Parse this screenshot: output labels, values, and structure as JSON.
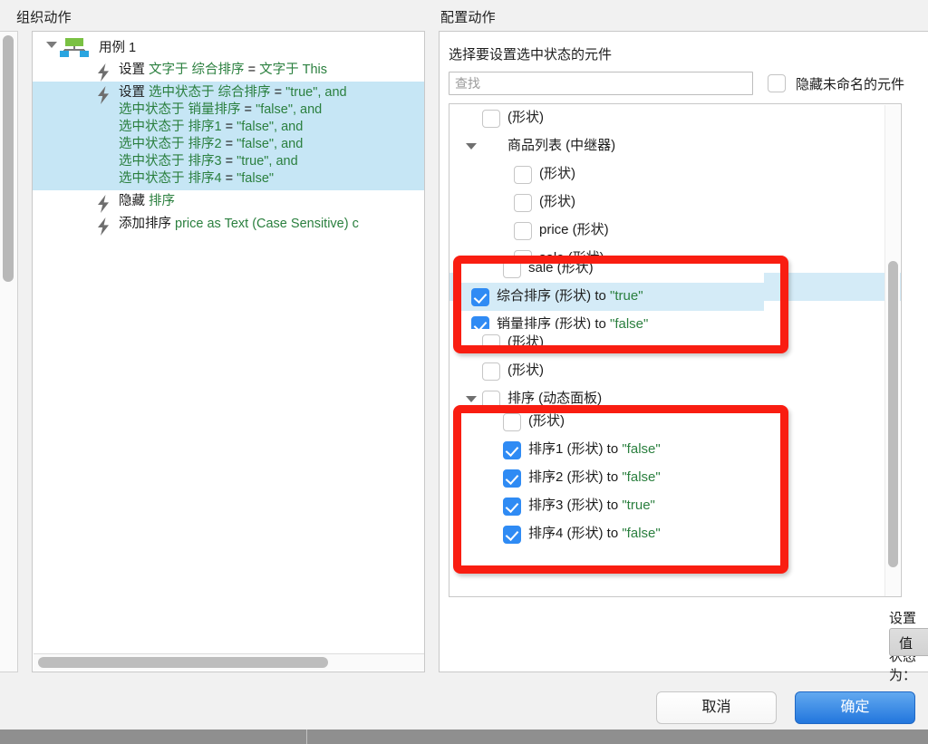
{
  "org": {
    "title": "组织动作",
    "root": {
      "label": "用例 1",
      "icon": "hierarchy-icon",
      "expanded": true
    },
    "actions": [
      {
        "selected": false,
        "lines": [
          [
            {
              "t": "设置 ",
              "c": "k"
            },
            {
              "t": "文字于 综合排序",
              "c": "g"
            },
            {
              "t": " = ",
              "c": "k"
            },
            {
              "t": "文字于 This",
              "c": "g"
            }
          ]
        ]
      },
      {
        "selected": true,
        "lines": [
          [
            {
              "t": "设置 ",
              "c": "k"
            },
            {
              "t": "选中状态于 综合排序",
              "c": "g"
            },
            {
              "t": " = ",
              "c": "k"
            },
            {
              "t": "\"true\", and",
              "c": "g"
            }
          ],
          [
            {
              "t": "选中状态于 销量排序",
              "c": "g"
            },
            {
              "t": " = ",
              "c": "k"
            },
            {
              "t": "\"false\", and",
              "c": "g"
            }
          ],
          [
            {
              "t": "选中状态于 排序1",
              "c": "g"
            },
            {
              "t": " = ",
              "c": "k"
            },
            {
              "t": "\"false\", and",
              "c": "g"
            }
          ],
          [
            {
              "t": "选中状态于 排序2",
              "c": "g"
            },
            {
              "t": " = ",
              "c": "k"
            },
            {
              "t": "\"false\", and",
              "c": "g"
            }
          ],
          [
            {
              "t": "选中状态于 排序3",
              "c": "g"
            },
            {
              "t": " = ",
              "c": "k"
            },
            {
              "t": "\"true\", and",
              "c": "g"
            }
          ],
          [
            {
              "t": "选中状态于 排序4",
              "c": "g"
            },
            {
              "t": " = ",
              "c": "k"
            },
            {
              "t": "\"false\"",
              "c": "g"
            }
          ]
        ]
      },
      {
        "selected": false,
        "lines": [
          [
            {
              "t": "隐藏 ",
              "c": "k"
            },
            {
              "t": "排序",
              "c": "g"
            }
          ]
        ]
      },
      {
        "selected": false,
        "lines": [
          [
            {
              "t": "添加排序 ",
              "c": "k"
            },
            {
              "t": "price as Text (Case Sensitive) c",
              "c": "g"
            }
          ]
        ]
      }
    ],
    "hscrollbar": true
  },
  "config": {
    "title": "配置动作",
    "subtitle": "选择要设置选中状态的元件",
    "search": {
      "value": "",
      "placeholder": "查找"
    },
    "hide_unnamed": {
      "label": "隐藏未命名的元件",
      "checked": false
    },
    "tree": [
      {
        "indent": 1,
        "triangle": false,
        "checked": false,
        "label": "(形状)",
        "value": "",
        "highlight": false
      },
      {
        "indent": 0,
        "triangle": true,
        "checkbox": false,
        "checked": false,
        "label": "商品列表 (中继器)",
        "value": "",
        "highlight": false
      },
      {
        "indent": 2,
        "triangle": false,
        "checked": false,
        "label": "(形状)",
        "value": "",
        "highlight": false
      },
      {
        "indent": 2,
        "triangle": false,
        "checked": false,
        "label": "(形状)",
        "value": "",
        "highlight": false
      },
      {
        "indent": 2,
        "triangle": false,
        "checked": false,
        "label": "price (形状)",
        "value": "",
        "highlight": false
      },
      {
        "indent": 2,
        "triangle": false,
        "checked": false,
        "label": "sale (形状)",
        "value": "",
        "highlight": false
      },
      {
        "indent": 1,
        "triangle": false,
        "checked": true,
        "label": "综合排序 (形状) to ",
        "value": "\"true\"",
        "highlight": true
      },
      {
        "indent": 1,
        "triangle": false,
        "checked": true,
        "label": "销量排序 (形状) to ",
        "value": "\"false\"",
        "highlight": false
      },
      {
        "indent": 1,
        "triangle": false,
        "checked": false,
        "label": "(形状)",
        "value": "",
        "highlight": false
      },
      {
        "indent": 1,
        "triangle": false,
        "checked": false,
        "label": "(形状)",
        "value": "",
        "highlight": false
      },
      {
        "indent": 1,
        "triangle": true,
        "checked": false,
        "label": "排序 (动态面板)",
        "value": "",
        "highlight": false
      },
      {
        "indent": 2,
        "triangle": false,
        "checked": false,
        "label": "(形状)",
        "value": "",
        "highlight": false
      },
      {
        "indent": 2,
        "triangle": false,
        "checked": true,
        "label": "排序1 (形状) to ",
        "value": "\"false\"",
        "highlight": false
      },
      {
        "indent": 2,
        "triangle": false,
        "checked": true,
        "label": "排序2 (形状) to ",
        "value": "\"false\"",
        "highlight": false
      },
      {
        "indent": 2,
        "triangle": false,
        "checked": true,
        "label": "排序3 (形状) to ",
        "value": "\"true\"",
        "highlight": false
      },
      {
        "indent": 2,
        "triangle": false,
        "checked": true,
        "label": "排序4 (形状) to ",
        "value": "\"false\"",
        "highlight": false
      }
    ],
    "set_state": {
      "label": "设置选中状态为：",
      "type_value": "值",
      "bool_value": "true"
    }
  },
  "footer": {
    "cancel_label": "取消",
    "ok_label": "确定"
  },
  "colors": {
    "accent_blue": "#2f8bf4",
    "ok_button": "#2276dd",
    "value_green": "#2a7f3e",
    "selection_blue": "#c6e6f5",
    "highlight_blue": "#d4ebf7",
    "annotation_red": "#f91d11"
  }
}
